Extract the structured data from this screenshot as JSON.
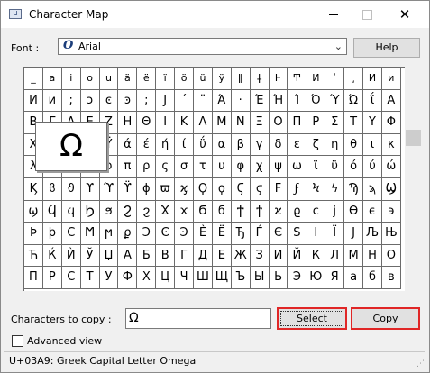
{
  "titlebar": {
    "title": "Character Map",
    "minimize": "minimize-icon",
    "maximize": "maximize-icon",
    "close_glyph": "✕"
  },
  "font": {
    "label": "Font :",
    "value": "Arial",
    "icon_glyph": "O",
    "arrow_glyph": "⌄"
  },
  "help_label": "Help",
  "grid": {
    "rows": [
      [
        "_",
        "a",
        "i",
        "o",
        "u",
        "ä",
        "ë",
        "ï",
        "ö",
        "ü",
        "ÿ",
        "ǁ",
        "ǂ",
        "Ͱ",
        "Ͳ",
        "Ͷ",
        "ʹ",
        "͵",
        "Ͷ",
        "ͷ"
      ],
      [
        "Ͷ",
        "ͷ",
        ";",
        "ͻ",
        "ͼ",
        "ͽ",
        ";",
        "Ϳ",
        "´",
        "¨",
        "Ά",
        "·",
        "Έ",
        "Ή",
        "Ί",
        "Ό",
        "Ύ",
        "Ώ",
        "ΐ",
        "Α"
      ],
      [
        "Β",
        "Γ",
        "Δ",
        "Ε",
        "Ζ",
        "Η",
        "Θ",
        "Ι",
        "Κ",
        "Λ",
        "Μ",
        "Ν",
        "Ξ",
        "Ο",
        "Π",
        "Ρ",
        "Σ",
        "Τ",
        "Υ",
        "Φ"
      ],
      [
        "Χ",
        "Ψ",
        "Ω",
        "Ϊ",
        "Ϋ",
        "ά",
        "έ",
        "ή",
        "ί",
        "ΰ",
        "α",
        "β",
        "γ",
        "δ",
        "ε",
        "ζ",
        "η",
        "θ",
        "ι",
        "κ"
      ],
      [
        "λ",
        "μ",
        "ν",
        "ξ",
        "ο",
        "π",
        "ρ",
        "ς",
        "σ",
        "τ",
        "υ",
        "φ",
        "χ",
        "ψ",
        "ω",
        "ϊ",
        "ϋ",
        "ό",
        "ύ",
        "ώ"
      ],
      [
        "Ϗ",
        "ϐ",
        "ϑ",
        "ϒ",
        "ϓ",
        "ϔ",
        "ϕ",
        "ϖ",
        "ϗ",
        "Ϙ",
        "ϙ",
        "Ϛ",
        "ϛ",
        "Ϝ",
        "ϝ",
        "Ϟ",
        "ϟ",
        "Ϡ",
        "ϡ",
        "Ϣ"
      ],
      [
        "ϣ",
        "Ϥ",
        "ϥ",
        "Ϧ",
        "ϧ",
        "Ϩ",
        "ϩ",
        "Ϫ",
        "ϫ",
        "Ϭ",
        "ϭ",
        "Ϯ",
        "ϯ",
        "ϰ",
        "ϱ",
        "ϲ",
        "ϳ",
        "ϴ",
        "ϵ",
        "϶"
      ],
      [
        "Ϸ",
        "ϸ",
        "Ϲ",
        "Ϻ",
        "ϻ",
        "ϼ",
        "Ͻ",
        "Ͼ",
        "Ͽ",
        "Ѐ",
        "Ё",
        "Ђ",
        "Ѓ",
        "Є",
        "Ѕ",
        "І",
        "Ї",
        "Ј",
        "Љ",
        "Њ"
      ],
      [
        "Ћ",
        "Ќ",
        "Ѝ",
        "Ў",
        "Џ",
        "А",
        "Б",
        "В",
        "Г",
        "Д",
        "Е",
        "Ж",
        "З",
        "И",
        "Й",
        "К",
        "Л",
        "М",
        "Н",
        "О"
      ],
      [
        "П",
        "Р",
        "С",
        "Т",
        "У",
        "Ф",
        "Х",
        "Ц",
        "Ч",
        "Ш",
        "Щ",
        "Ъ",
        "Ы",
        "Ь",
        "Э",
        "Ю",
        "Я",
        "а",
        "б",
        "в"
      ]
    ]
  },
  "zoom_char": "Ω",
  "copy": {
    "label": "Characters to copy :",
    "value": "Ω",
    "select_label": "Select",
    "copy_label": "Copy"
  },
  "advanced_label": "Advanced view",
  "status": "U+03A9: Greek Capital Letter Omega"
}
